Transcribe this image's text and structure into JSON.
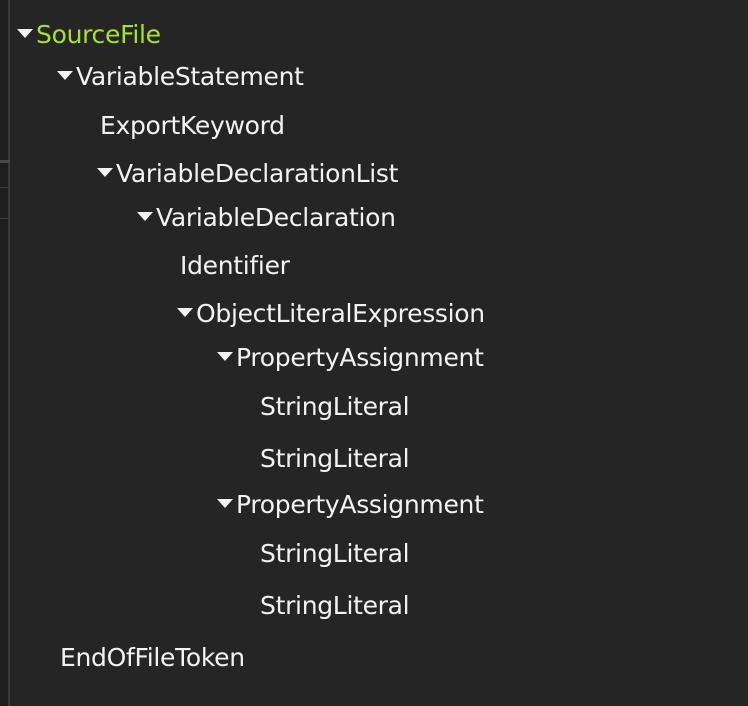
{
  "tree": {
    "root": {
      "label": "SourceFile",
      "expanded": true,
      "highlight_color": "#a6e22e"
    },
    "nodes": [
      {
        "label": "VariableStatement",
        "expanded": true
      },
      {
        "label": "ExportKeyword",
        "expanded": false
      },
      {
        "label": "VariableDeclarationList",
        "expanded": true
      },
      {
        "label": "VariableDeclaration",
        "expanded": true
      },
      {
        "label": "Identifier",
        "expanded": false
      },
      {
        "label": "ObjectLiteralExpression",
        "expanded": true
      },
      {
        "label": "PropertyAssignment",
        "expanded": true
      },
      {
        "label": "StringLiteral",
        "expanded": false
      },
      {
        "label": "StringLiteral",
        "expanded": false
      },
      {
        "label": "PropertyAssignment",
        "expanded": true
      },
      {
        "label": "StringLiteral",
        "expanded": false
      },
      {
        "label": "StringLiteral",
        "expanded": false
      },
      {
        "label": "EndOfFileToken",
        "expanded": false
      }
    ]
  },
  "icons": {
    "expanded_caret": "caret-down-icon"
  },
  "colors": {
    "background": "#252526",
    "text": "#f2f2f2",
    "selected_text": "#a6e22e"
  }
}
